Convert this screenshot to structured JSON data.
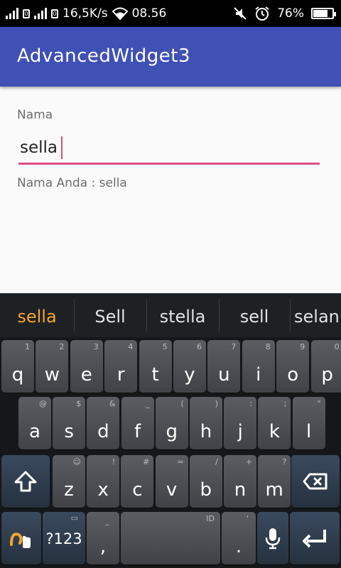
{
  "status_bar": {
    "speed": "16,5K/s",
    "time": "08.56",
    "battery_percent": "76%",
    "battery_level": 0.76
  },
  "app": {
    "title": "AdvancedWidget3"
  },
  "form": {
    "label": "Nama",
    "input_value": "sella",
    "result_text": "Nama Anda : sella"
  },
  "keyboard": {
    "suggestions": [
      "sella",
      "Sell",
      "stella",
      "sell",
      "selan"
    ],
    "row1": [
      {
        "key": "q",
        "hint": "1"
      },
      {
        "key": "w",
        "hint": "2"
      },
      {
        "key": "e",
        "hint": "3"
      },
      {
        "key": "r",
        "hint": "4"
      },
      {
        "key": "t",
        "hint": "5"
      },
      {
        "key": "y",
        "hint": "6"
      },
      {
        "key": "u",
        "hint": "7"
      },
      {
        "key": "i",
        "hint": "8"
      },
      {
        "key": "o",
        "hint": "9"
      },
      {
        "key": "p",
        "hint": "0"
      }
    ],
    "row2": [
      {
        "key": "a",
        "hint": "@"
      },
      {
        "key": "s",
        "hint": "$"
      },
      {
        "key": "d",
        "hint": "&"
      },
      {
        "key": "f",
        "hint": "_"
      },
      {
        "key": "g",
        "hint": "("
      },
      {
        "key": "h",
        "hint": ")"
      },
      {
        "key": "j",
        "hint": ":"
      },
      {
        "key": "k",
        "hint": ";"
      },
      {
        "key": "l",
        "hint": "\""
      }
    ],
    "row3": [
      {
        "key": "z",
        "hint": "☺"
      },
      {
        "key": "x",
        "hint": "!"
      },
      {
        "key": "c",
        "hint": "#"
      },
      {
        "key": "v",
        "hint": "="
      },
      {
        "key": "b",
        "hint": "/"
      },
      {
        "key": "n",
        "hint": "+"
      },
      {
        "key": "m",
        "hint": "?"
      }
    ],
    "symbols_label": "?123",
    "comma_label": ",",
    "comma_hint": "_",
    "space_hint": "ID",
    "period_label": ".",
    "period_hint": "'"
  }
}
